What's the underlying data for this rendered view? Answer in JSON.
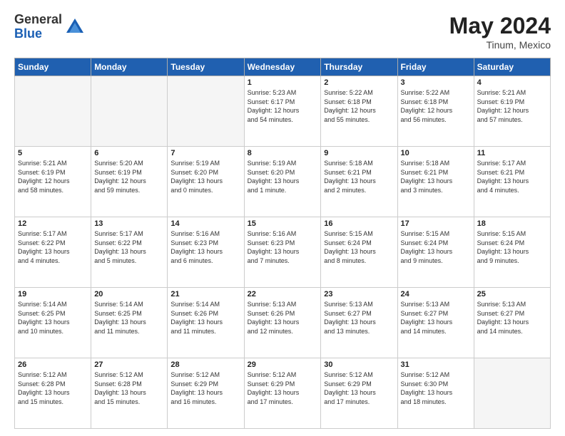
{
  "header": {
    "logo_general": "General",
    "logo_blue": "Blue",
    "month_year": "May 2024",
    "location": "Tinum, Mexico"
  },
  "weekdays": [
    "Sunday",
    "Monday",
    "Tuesday",
    "Wednesday",
    "Thursday",
    "Friday",
    "Saturday"
  ],
  "weeks": [
    [
      {
        "day": "",
        "info": ""
      },
      {
        "day": "",
        "info": ""
      },
      {
        "day": "",
        "info": ""
      },
      {
        "day": "1",
        "info": "Sunrise: 5:23 AM\nSunset: 6:17 PM\nDaylight: 12 hours\nand 54 minutes."
      },
      {
        "day": "2",
        "info": "Sunrise: 5:22 AM\nSunset: 6:18 PM\nDaylight: 12 hours\nand 55 minutes."
      },
      {
        "day": "3",
        "info": "Sunrise: 5:22 AM\nSunset: 6:18 PM\nDaylight: 12 hours\nand 56 minutes."
      },
      {
        "day": "4",
        "info": "Sunrise: 5:21 AM\nSunset: 6:19 PM\nDaylight: 12 hours\nand 57 minutes."
      }
    ],
    [
      {
        "day": "5",
        "info": "Sunrise: 5:21 AM\nSunset: 6:19 PM\nDaylight: 12 hours\nand 58 minutes."
      },
      {
        "day": "6",
        "info": "Sunrise: 5:20 AM\nSunset: 6:19 PM\nDaylight: 12 hours\nand 59 minutes."
      },
      {
        "day": "7",
        "info": "Sunrise: 5:19 AM\nSunset: 6:20 PM\nDaylight: 13 hours\nand 0 minutes."
      },
      {
        "day": "8",
        "info": "Sunrise: 5:19 AM\nSunset: 6:20 PM\nDaylight: 13 hours\nand 1 minute."
      },
      {
        "day": "9",
        "info": "Sunrise: 5:18 AM\nSunset: 6:21 PM\nDaylight: 13 hours\nand 2 minutes."
      },
      {
        "day": "10",
        "info": "Sunrise: 5:18 AM\nSunset: 6:21 PM\nDaylight: 13 hours\nand 3 minutes."
      },
      {
        "day": "11",
        "info": "Sunrise: 5:17 AM\nSunset: 6:21 PM\nDaylight: 13 hours\nand 4 minutes."
      }
    ],
    [
      {
        "day": "12",
        "info": "Sunrise: 5:17 AM\nSunset: 6:22 PM\nDaylight: 13 hours\nand 4 minutes."
      },
      {
        "day": "13",
        "info": "Sunrise: 5:17 AM\nSunset: 6:22 PM\nDaylight: 13 hours\nand 5 minutes."
      },
      {
        "day": "14",
        "info": "Sunrise: 5:16 AM\nSunset: 6:23 PM\nDaylight: 13 hours\nand 6 minutes."
      },
      {
        "day": "15",
        "info": "Sunrise: 5:16 AM\nSunset: 6:23 PM\nDaylight: 13 hours\nand 7 minutes."
      },
      {
        "day": "16",
        "info": "Sunrise: 5:15 AM\nSunset: 6:24 PM\nDaylight: 13 hours\nand 8 minutes."
      },
      {
        "day": "17",
        "info": "Sunrise: 5:15 AM\nSunset: 6:24 PM\nDaylight: 13 hours\nand 9 minutes."
      },
      {
        "day": "18",
        "info": "Sunrise: 5:15 AM\nSunset: 6:24 PM\nDaylight: 13 hours\nand 9 minutes."
      }
    ],
    [
      {
        "day": "19",
        "info": "Sunrise: 5:14 AM\nSunset: 6:25 PM\nDaylight: 13 hours\nand 10 minutes."
      },
      {
        "day": "20",
        "info": "Sunrise: 5:14 AM\nSunset: 6:25 PM\nDaylight: 13 hours\nand 11 minutes."
      },
      {
        "day": "21",
        "info": "Sunrise: 5:14 AM\nSunset: 6:26 PM\nDaylight: 13 hours\nand 11 minutes."
      },
      {
        "day": "22",
        "info": "Sunrise: 5:13 AM\nSunset: 6:26 PM\nDaylight: 13 hours\nand 12 minutes."
      },
      {
        "day": "23",
        "info": "Sunrise: 5:13 AM\nSunset: 6:27 PM\nDaylight: 13 hours\nand 13 minutes."
      },
      {
        "day": "24",
        "info": "Sunrise: 5:13 AM\nSunset: 6:27 PM\nDaylight: 13 hours\nand 14 minutes."
      },
      {
        "day": "25",
        "info": "Sunrise: 5:13 AM\nSunset: 6:27 PM\nDaylight: 13 hours\nand 14 minutes."
      }
    ],
    [
      {
        "day": "26",
        "info": "Sunrise: 5:12 AM\nSunset: 6:28 PM\nDaylight: 13 hours\nand 15 minutes."
      },
      {
        "day": "27",
        "info": "Sunrise: 5:12 AM\nSunset: 6:28 PM\nDaylight: 13 hours\nand 15 minutes."
      },
      {
        "day": "28",
        "info": "Sunrise: 5:12 AM\nSunset: 6:29 PM\nDaylight: 13 hours\nand 16 minutes."
      },
      {
        "day": "29",
        "info": "Sunrise: 5:12 AM\nSunset: 6:29 PM\nDaylight: 13 hours\nand 17 minutes."
      },
      {
        "day": "30",
        "info": "Sunrise: 5:12 AM\nSunset: 6:29 PM\nDaylight: 13 hours\nand 17 minutes."
      },
      {
        "day": "31",
        "info": "Sunrise: 5:12 AM\nSunset: 6:30 PM\nDaylight: 13 hours\nand 18 minutes."
      },
      {
        "day": "",
        "info": ""
      }
    ]
  ]
}
